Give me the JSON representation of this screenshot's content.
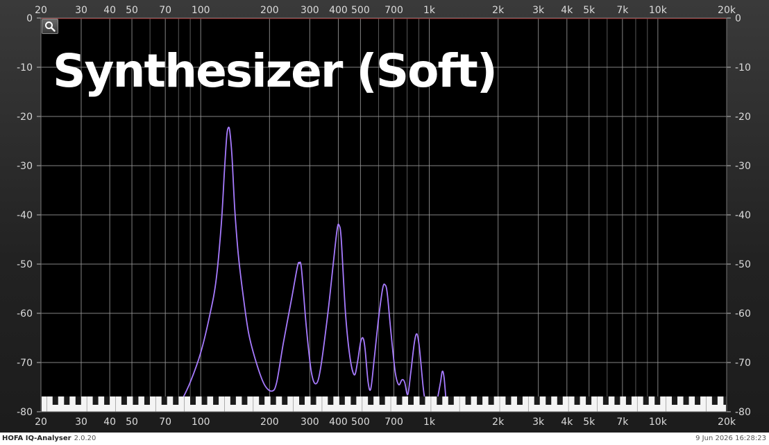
{
  "chart_data": {
    "type": "line",
    "title": "Synthesizer (Soft)",
    "x_scale": "log",
    "xlim": [
      20,
      20000
    ],
    "ylim": [
      -80,
      0
    ],
    "x_tick_labels": [
      "20",
      "30",
      "40",
      "50",
      "70",
      "100",
      "200",
      "300",
      "400",
      "500",
      "700",
      "1k",
      "2k",
      "3k",
      "4k",
      "5k",
      "7k",
      "10k",
      "20k"
    ],
    "x_tick_values": [
      20,
      30,
      40,
      50,
      70,
      100,
      200,
      300,
      400,
      500,
      700,
      1000,
      2000,
      3000,
      4000,
      5000,
      7000,
      10000,
      20000
    ],
    "y_tick_labels": [
      "0",
      "-10",
      "-20",
      "-30",
      "-40",
      "-50",
      "-60",
      "-70",
      "-80"
    ],
    "y_tick_values": [
      0,
      -10,
      -20,
      -30,
      -40,
      -50,
      -60,
      -70,
      -80
    ],
    "grid": true,
    "series": [
      {
        "color": "#a77bff",
        "points": [
          [
            82,
            -78
          ],
          [
            90,
            -74
          ],
          [
            100,
            -68
          ],
          [
            110,
            -60
          ],
          [
            117,
            -53
          ],
          [
            123,
            -42
          ],
          [
            127,
            -31
          ],
          [
            130,
            -24
          ],
          [
            132,
            -22.3
          ],
          [
            134,
            -23
          ],
          [
            137,
            -28
          ],
          [
            141,
            -39
          ],
          [
            146,
            -48
          ],
          [
            153,
            -56
          ],
          [
            162,
            -64
          ],
          [
            175,
            -70
          ],
          [
            190,
            -74.5
          ],
          [
            205,
            -75.8
          ],
          [
            215,
            -74
          ],
          [
            230,
            -66
          ],
          [
            250,
            -57
          ],
          [
            265,
            -50.5
          ],
          [
            270,
            -49.8
          ],
          [
            276,
            -51
          ],
          [
            290,
            -63
          ],
          [
            305,
            -72
          ],
          [
            320,
            -74.3
          ],
          [
            335,
            -71
          ],
          [
            360,
            -60
          ],
          [
            380,
            -50
          ],
          [
            395,
            -43
          ],
          [
            403,
            -42.1
          ],
          [
            412,
            -45
          ],
          [
            430,
            -60
          ],
          [
            450,
            -69
          ],
          [
            470,
            -72.5
          ],
          [
            485,
            -70
          ],
          [
            500,
            -66
          ],
          [
            512,
            -65
          ],
          [
            523,
            -67
          ],
          [
            540,
            -74
          ],
          [
            555,
            -75.3
          ],
          [
            575,
            -69
          ],
          [
            600,
            -61
          ],
          [
            625,
            -55
          ],
          [
            640,
            -54.2
          ],
          [
            655,
            -56
          ],
          [
            680,
            -64
          ],
          [
            710,
            -72
          ],
          [
            735,
            -74.5
          ],
          [
            760,
            -73.5
          ],
          [
            780,
            -74
          ],
          [
            805,
            -76.5
          ],
          [
            830,
            -72
          ],
          [
            860,
            -66
          ],
          [
            883,
            -64.2
          ],
          [
            905,
            -67
          ],
          [
            940,
            -75
          ],
          [
            960,
            -78
          ]
        ]
      },
      {
        "color": "#a77bff",
        "points": [
          [
            1080,
            -78
          ],
          [
            1120,
            -74
          ],
          [
            1140,
            -71.8
          ],
          [
            1160,
            -73
          ],
          [
            1185,
            -78
          ]
        ]
      }
    ]
  },
  "status": {
    "app_name": "HOFA IQ-Analyser",
    "version": "2.0.20",
    "timestamp": "9 Jun 2026 16:28:23"
  },
  "icons": {
    "zoom": "magnifier-icon"
  }
}
